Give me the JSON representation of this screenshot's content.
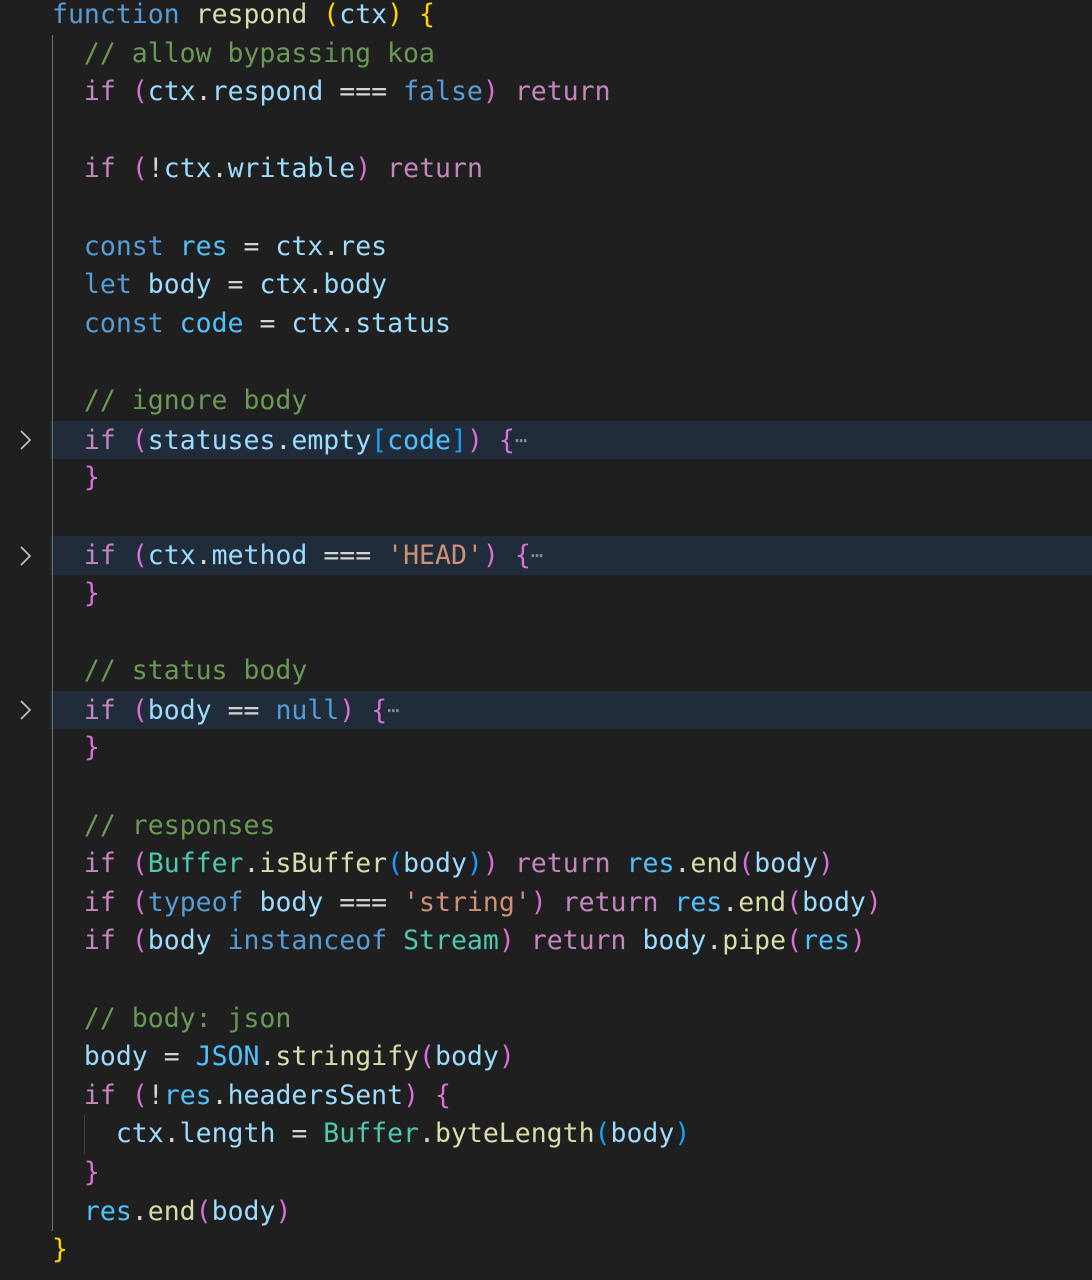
{
  "editor": {
    "language": "javascript",
    "theme_colors": {
      "background": "#1f1f1f",
      "folded_line_highlight": "#202c3a",
      "keyword_control": "#c586c0",
      "keyword_storage": "#569cd6",
      "function": "#dcdcaa",
      "variable": "#9cdcfe",
      "constant": "#4fc1ff",
      "class": "#4ec9b0",
      "string": "#ce9178",
      "comment": "#6a9955",
      "operator": "#d4d4d4",
      "bracket_level_1": "#ffd700",
      "bracket_level_2": "#da70d6",
      "bracket_level_3": "#179fff"
    },
    "lines": [
      {
        "folded": false,
        "tokens": [
          [
            "function",
            "kw2"
          ],
          [
            " ",
            ""
          ],
          [
            "respond",
            "fn"
          ],
          [
            " ",
            ""
          ],
          [
            "(",
            "b1"
          ],
          [
            "ctx",
            "var"
          ],
          [
            ")",
            "b1"
          ],
          [
            " ",
            ""
          ],
          [
            "{",
            "b1"
          ]
        ]
      },
      {
        "folded": false,
        "tokens": [
          [
            "  ",
            ""
          ],
          [
            "// allow bypassing koa",
            "cm"
          ]
        ]
      },
      {
        "folded": false,
        "tokens": [
          [
            "  ",
            ""
          ],
          [
            "if",
            "kw"
          ],
          [
            " ",
            ""
          ],
          [
            "(",
            "b2"
          ],
          [
            "ctx",
            "var"
          ],
          [
            ".",
            ""
          ],
          [
            "respond",
            "var"
          ],
          [
            " === ",
            ""
          ],
          [
            "false",
            "kw2"
          ],
          [
            ")",
            "b2"
          ],
          [
            " ",
            ""
          ],
          [
            "return",
            "kw"
          ]
        ]
      },
      {
        "folded": false,
        "tokens": []
      },
      {
        "folded": false,
        "tokens": [
          [
            "  ",
            ""
          ],
          [
            "if",
            "kw"
          ],
          [
            " ",
            ""
          ],
          [
            "(",
            "b2"
          ],
          [
            "!",
            ""
          ],
          [
            "ctx",
            "var"
          ],
          [
            ".",
            ""
          ],
          [
            "writable",
            "var"
          ],
          [
            ")",
            "b2"
          ],
          [
            " ",
            ""
          ],
          [
            "return",
            "kw"
          ]
        ]
      },
      {
        "folded": false,
        "tokens": []
      },
      {
        "folded": false,
        "tokens": [
          [
            "  ",
            ""
          ],
          [
            "const",
            "kw2"
          ],
          [
            " ",
            ""
          ],
          [
            "res",
            "cst"
          ],
          [
            " = ",
            ""
          ],
          [
            "ctx",
            "var"
          ],
          [
            ".",
            ""
          ],
          [
            "res",
            "var"
          ]
        ]
      },
      {
        "folded": false,
        "tokens": [
          [
            "  ",
            ""
          ],
          [
            "let",
            "kw2"
          ],
          [
            " ",
            ""
          ],
          [
            "body",
            "var"
          ],
          [
            " = ",
            ""
          ],
          [
            "ctx",
            "var"
          ],
          [
            ".",
            ""
          ],
          [
            "body",
            "var"
          ]
        ]
      },
      {
        "folded": false,
        "tokens": [
          [
            "  ",
            ""
          ],
          [
            "const",
            "kw2"
          ],
          [
            " ",
            ""
          ],
          [
            "code",
            "cst"
          ],
          [
            " = ",
            ""
          ],
          [
            "ctx",
            "var"
          ],
          [
            ".",
            ""
          ],
          [
            "status",
            "var"
          ]
        ]
      },
      {
        "folded": false,
        "tokens": []
      },
      {
        "folded": false,
        "tokens": [
          [
            "  ",
            ""
          ],
          [
            "// ignore body",
            "cm"
          ]
        ]
      },
      {
        "folded": true,
        "tokens": [
          [
            "  ",
            ""
          ],
          [
            "if",
            "kw"
          ],
          [
            " ",
            ""
          ],
          [
            "(",
            "b2"
          ],
          [
            "statuses",
            "var"
          ],
          [
            ".",
            ""
          ],
          [
            "empty",
            "var"
          ],
          [
            "[",
            "b3"
          ],
          [
            "code",
            "cst"
          ],
          [
            "]",
            "b3"
          ],
          [
            ")",
            "b2"
          ],
          [
            " ",
            ""
          ],
          [
            "{",
            "b2"
          ]
        ],
        "ellipsis": "⋯"
      },
      {
        "folded": false,
        "tokens": [
          [
            "  ",
            ""
          ],
          [
            "}",
            "b2"
          ]
        ]
      },
      {
        "folded": false,
        "tokens": []
      },
      {
        "folded": true,
        "tokens": [
          [
            "  ",
            ""
          ],
          [
            "if",
            "kw"
          ],
          [
            " ",
            ""
          ],
          [
            "(",
            "b2"
          ],
          [
            "ctx",
            "var"
          ],
          [
            ".",
            ""
          ],
          [
            "method",
            "var"
          ],
          [
            " === ",
            ""
          ],
          [
            "'HEAD'",
            "str"
          ],
          [
            ")",
            "b2"
          ],
          [
            " ",
            ""
          ],
          [
            "{",
            "b2"
          ]
        ],
        "ellipsis": "⋯"
      },
      {
        "folded": false,
        "tokens": [
          [
            "  ",
            ""
          ],
          [
            "}",
            "b2"
          ]
        ]
      },
      {
        "folded": false,
        "tokens": []
      },
      {
        "folded": false,
        "tokens": [
          [
            "  ",
            ""
          ],
          [
            "// status body",
            "cm"
          ]
        ]
      },
      {
        "folded": true,
        "tokens": [
          [
            "  ",
            ""
          ],
          [
            "if",
            "kw"
          ],
          [
            " ",
            ""
          ],
          [
            "(",
            "b2"
          ],
          [
            "body",
            "var"
          ],
          [
            " == ",
            ""
          ],
          [
            "null",
            "kw2"
          ],
          [
            ")",
            "b2"
          ],
          [
            " ",
            ""
          ],
          [
            "{",
            "b2"
          ]
        ],
        "ellipsis": "⋯"
      },
      {
        "folded": false,
        "tokens": [
          [
            "  ",
            ""
          ],
          [
            "}",
            "b2"
          ]
        ]
      },
      {
        "folded": false,
        "tokens": []
      },
      {
        "folded": false,
        "tokens": [
          [
            "  ",
            ""
          ],
          [
            "// responses",
            "cm"
          ]
        ]
      },
      {
        "folded": false,
        "tokens": [
          [
            "  ",
            ""
          ],
          [
            "if",
            "kw"
          ],
          [
            " ",
            ""
          ],
          [
            "(",
            "b2"
          ],
          [
            "Buffer",
            "cls"
          ],
          [
            ".",
            ""
          ],
          [
            "isBuffer",
            "fn"
          ],
          [
            "(",
            "b3"
          ],
          [
            "body",
            "var"
          ],
          [
            ")",
            "b3"
          ],
          [
            ")",
            "b2"
          ],
          [
            " ",
            ""
          ],
          [
            "return",
            "kw"
          ],
          [
            " ",
            ""
          ],
          [
            "res",
            "cst"
          ],
          [
            ".",
            ""
          ],
          [
            "end",
            "fn"
          ],
          [
            "(",
            "b2"
          ],
          [
            "body",
            "var"
          ],
          [
            ")",
            "b2"
          ]
        ]
      },
      {
        "folded": false,
        "tokens": [
          [
            "  ",
            ""
          ],
          [
            "if",
            "kw"
          ],
          [
            " ",
            ""
          ],
          [
            "(",
            "b2"
          ],
          [
            "typeof",
            "kw2"
          ],
          [
            " ",
            ""
          ],
          [
            "body",
            "var"
          ],
          [
            " === ",
            ""
          ],
          [
            "'string'",
            "str"
          ],
          [
            ")",
            "b2"
          ],
          [
            " ",
            ""
          ],
          [
            "return",
            "kw"
          ],
          [
            " ",
            ""
          ],
          [
            "res",
            "cst"
          ],
          [
            ".",
            ""
          ],
          [
            "end",
            "fn"
          ],
          [
            "(",
            "b2"
          ],
          [
            "body",
            "var"
          ],
          [
            ")",
            "b2"
          ]
        ]
      },
      {
        "folded": false,
        "tokens": [
          [
            "  ",
            ""
          ],
          [
            "if",
            "kw"
          ],
          [
            " ",
            ""
          ],
          [
            "(",
            "b2"
          ],
          [
            "body",
            "var"
          ],
          [
            " ",
            ""
          ],
          [
            "instanceof",
            "kw2"
          ],
          [
            " ",
            ""
          ],
          [
            "Stream",
            "cls"
          ],
          [
            ")",
            "b2"
          ],
          [
            " ",
            ""
          ],
          [
            "return",
            "kw"
          ],
          [
            " ",
            ""
          ],
          [
            "body",
            "var"
          ],
          [
            ".",
            ""
          ],
          [
            "pipe",
            "fn"
          ],
          [
            "(",
            "b2"
          ],
          [
            "res",
            "cst"
          ],
          [
            ")",
            "b2"
          ]
        ]
      },
      {
        "folded": false,
        "tokens": []
      },
      {
        "folded": false,
        "tokens": [
          [
            "  ",
            ""
          ],
          [
            "// body: json",
            "cm"
          ]
        ]
      },
      {
        "folded": false,
        "tokens": [
          [
            "  ",
            ""
          ],
          [
            "body",
            "var"
          ],
          [
            " = ",
            ""
          ],
          [
            "JSON",
            "cst"
          ],
          [
            ".",
            ""
          ],
          [
            "stringify",
            "fn"
          ],
          [
            "(",
            "b2"
          ],
          [
            "body",
            "var"
          ],
          [
            ")",
            "b2"
          ]
        ]
      },
      {
        "folded": false,
        "tokens": [
          [
            "  ",
            ""
          ],
          [
            "if",
            "kw"
          ],
          [
            " ",
            ""
          ],
          [
            "(",
            "b2"
          ],
          [
            "!",
            ""
          ],
          [
            "res",
            "cst"
          ],
          [
            ".",
            ""
          ],
          [
            "headersSent",
            "var"
          ],
          [
            ")",
            "b2"
          ],
          [
            " ",
            ""
          ],
          [
            "{",
            "b2"
          ]
        ]
      },
      {
        "folded": false,
        "tokens": [
          [
            "    ",
            ""
          ],
          [
            "ctx",
            "var"
          ],
          [
            ".",
            ""
          ],
          [
            "length",
            "var"
          ],
          [
            " = ",
            ""
          ],
          [
            "Buffer",
            "cls"
          ],
          [
            ".",
            ""
          ],
          [
            "byteLength",
            "fn"
          ],
          [
            "(",
            "b3"
          ],
          [
            "body",
            "var"
          ],
          [
            ")",
            "b3"
          ]
        ]
      },
      {
        "folded": false,
        "tokens": [
          [
            "  ",
            ""
          ],
          [
            "}",
            "b2"
          ]
        ]
      },
      {
        "folded": false,
        "tokens": [
          [
            "  ",
            ""
          ],
          [
            "res",
            "cst"
          ],
          [
            ".",
            ""
          ],
          [
            "end",
            "fn"
          ],
          [
            "(",
            "b2"
          ],
          [
            "body",
            "var"
          ],
          [
            ")",
            "b2"
          ]
        ]
      },
      {
        "folded": false,
        "tokens": [
          [
            "}",
            "b1"
          ]
        ]
      }
    ]
  }
}
